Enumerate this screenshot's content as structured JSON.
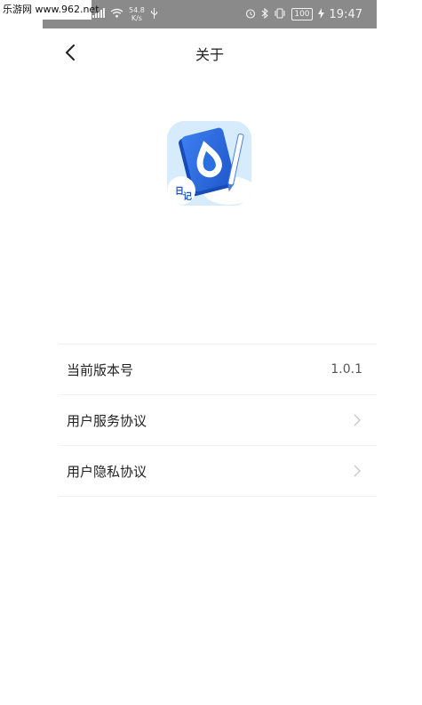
{
  "watermark": {
    "text": "乐游网 www.962.net"
  },
  "statusbar": {
    "speed_value": "54.8",
    "speed_unit": "K/s",
    "battery": "100",
    "time": "19:47"
  },
  "navbar": {
    "title": "关于"
  },
  "app": {
    "logo_char_1": "日",
    "logo_char_2": "记"
  },
  "list": {
    "version_label": "当前版本号",
    "version_value": "1.0.1",
    "service_label": "用户服务协议",
    "privacy_label": "用户隐私协议"
  }
}
